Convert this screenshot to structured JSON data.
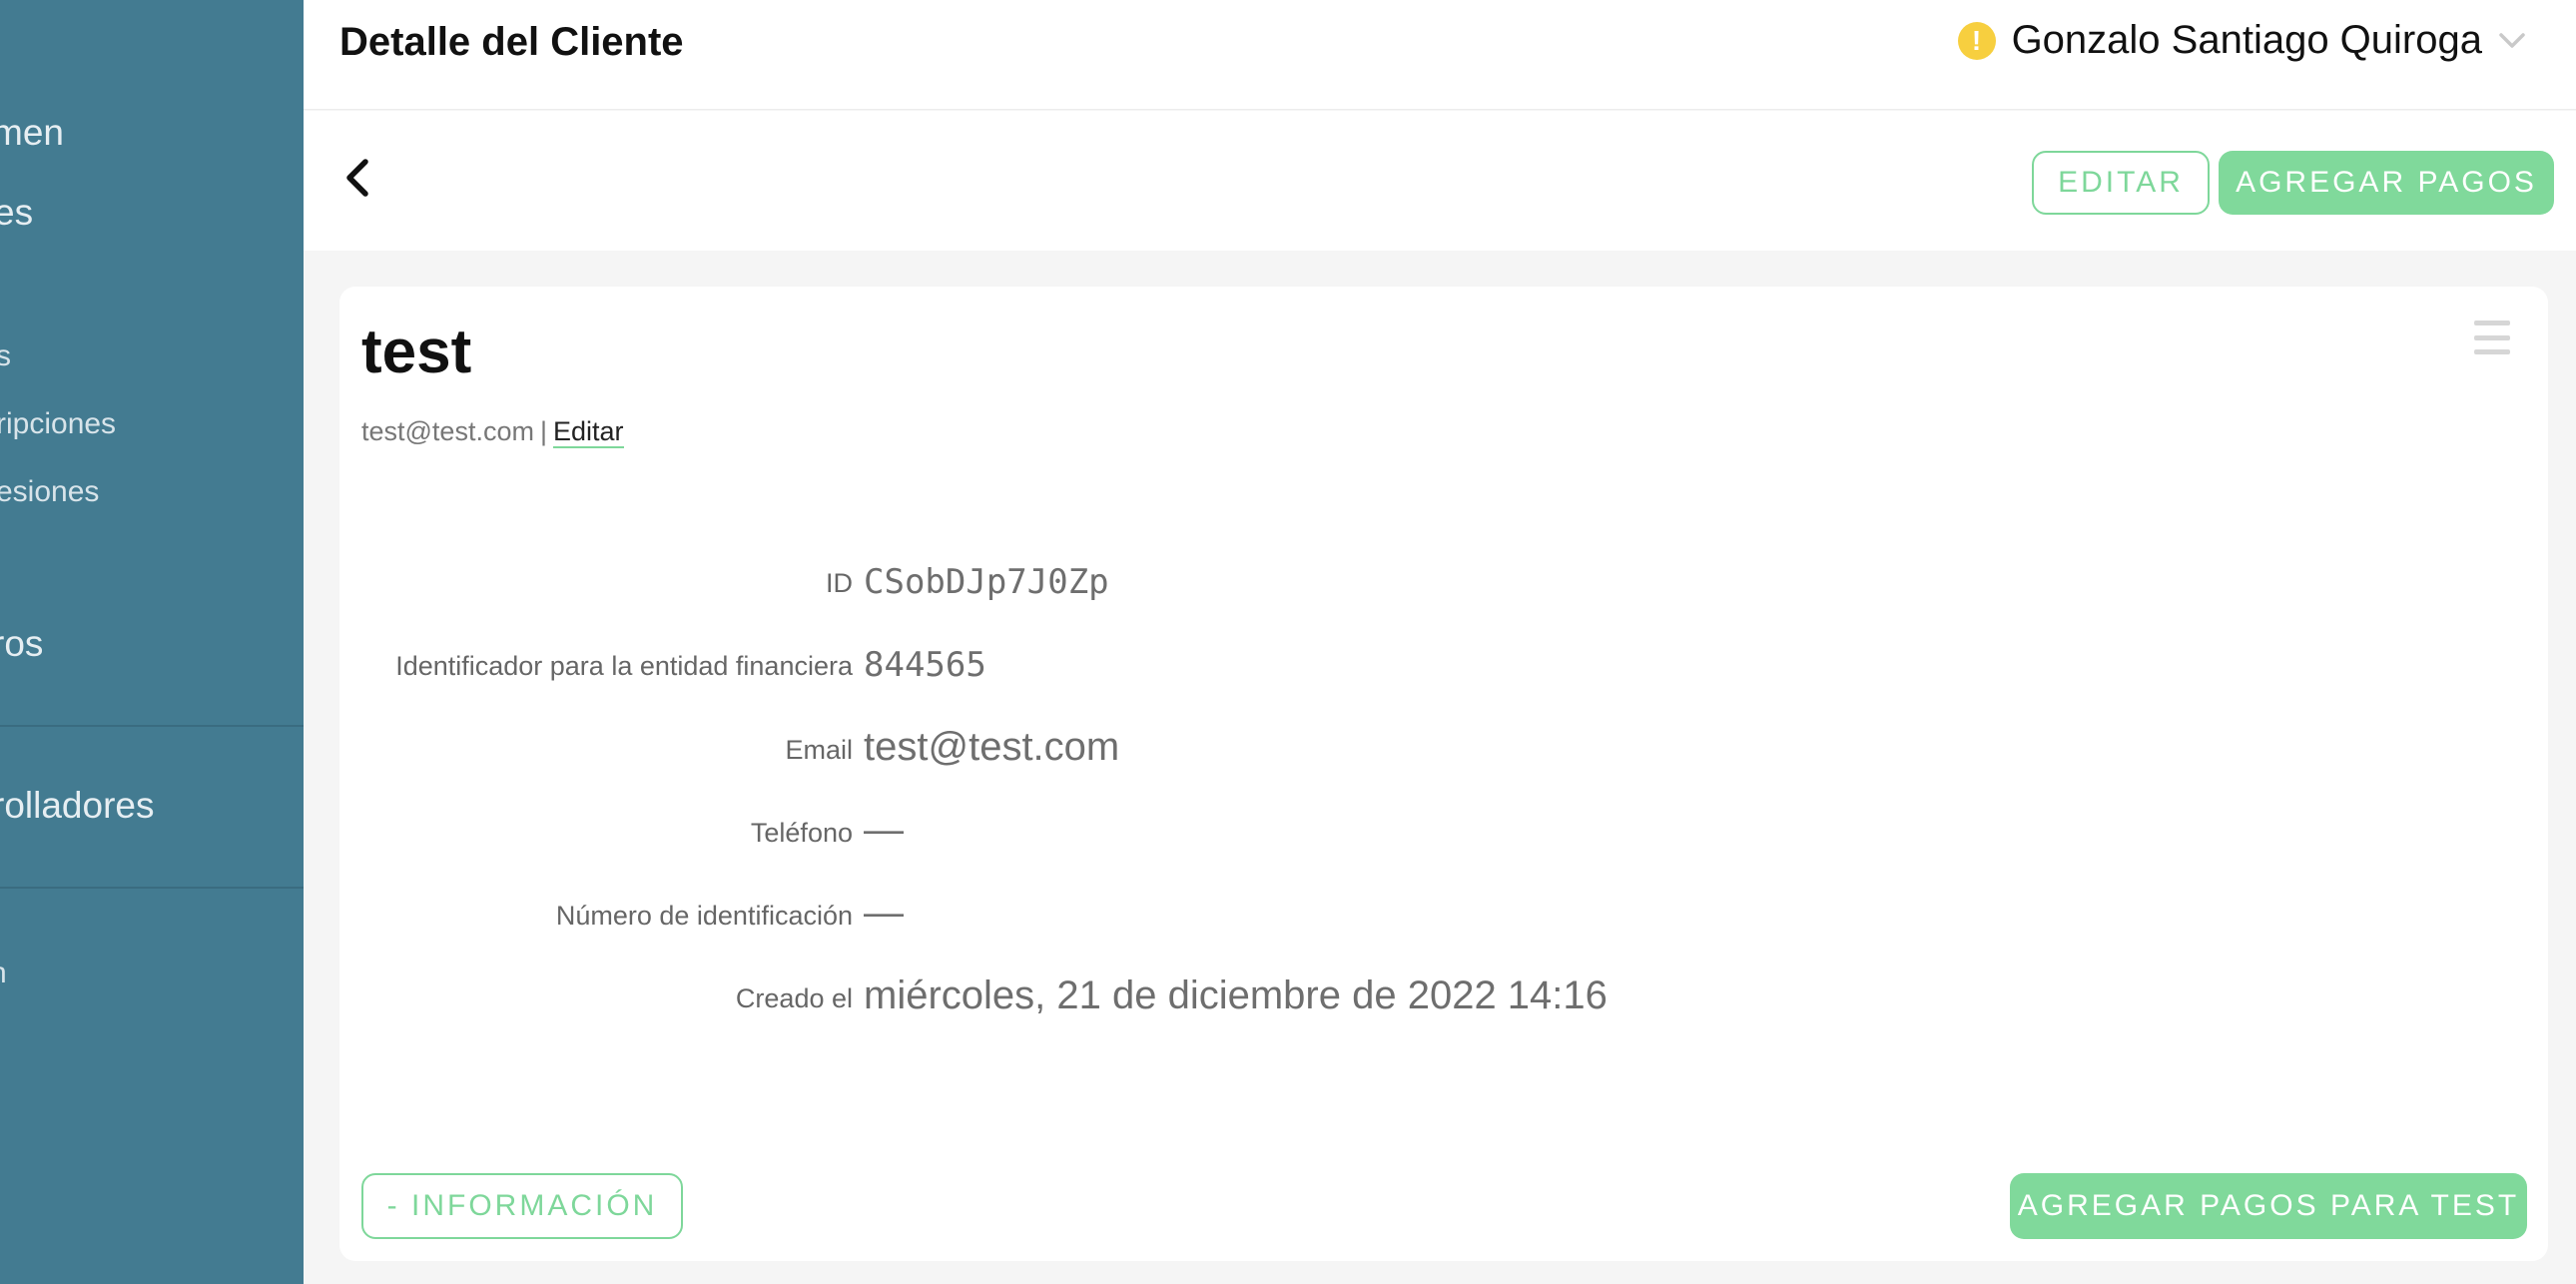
{
  "sidebar": {
    "items": [
      {
        "label": "men"
      },
      {
        "label": "es"
      },
      {
        "label": "s"
      },
      {
        "label": "ripciones"
      },
      {
        "label": "esiones"
      },
      {
        "label": "ros"
      },
      {
        "label": "rolladores"
      },
      {
        "label": "n"
      }
    ]
  },
  "header": {
    "title": "Detalle del Cliente",
    "user_name": "Gonzalo Santiago Quiroga",
    "warning_icon": "!"
  },
  "actions": {
    "edit_label": "EDITAR",
    "add_payments_label": "AGREGAR PAGOS"
  },
  "customer": {
    "name": "test",
    "email": "test@test.com",
    "separator": "|",
    "edit_link": "Editar",
    "details": [
      {
        "label": "ID",
        "value": "CSobDJp7J0Zp"
      },
      {
        "label": "Identificador para la entidad financiera",
        "value": "844565"
      },
      {
        "label": "Email",
        "value": "test@test.com"
      },
      {
        "label": "Teléfono",
        "value": "—"
      },
      {
        "label": "Número de identificación",
        "value": "—"
      },
      {
        "label": "Creado el",
        "value": "miércoles, 21 de diciembre de 2022 14:16"
      }
    ]
  },
  "footer": {
    "info_toggle_label": "- INFORMACIÓN",
    "add_payments_for_label": "AGREGAR PAGOS PARA TEST"
  },
  "colors": {
    "sidebar_bg": "#437b91",
    "accent_green": "#80d99b",
    "warning_yellow": "#f7cf3f"
  }
}
